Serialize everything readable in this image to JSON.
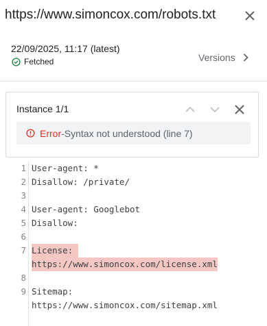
{
  "header": {
    "url": "https://www.simoncox.com/robots.txt",
    "close_icon": "close-icon"
  },
  "fetch": {
    "date": "22/09/2025, 11:17 (latest)",
    "status": "Fetched",
    "status_icon": "check-circle-icon",
    "versions_label": "Versions"
  },
  "instance": {
    "label": "Instance 1/1",
    "error_word": "Error",
    "separator": " - ",
    "error_message": "Syntax not understood (line 7)"
  },
  "colors": {
    "error": "#d93025",
    "success": "#188038",
    "highlight": "#f4c7c3"
  },
  "code": {
    "lines": [
      {
        "num": "1",
        "text": "User-agent: *"
      },
      {
        "num": "2",
        "text": "Disallow: /private/"
      },
      {
        "num": "3",
        "text": ""
      },
      {
        "num": "4",
        "text": "User-agent: Googlebot"
      },
      {
        "num": "5",
        "text": "Disallow:"
      },
      {
        "num": "6",
        "text": ""
      },
      {
        "num": "7",
        "text": "License: "
      },
      {
        "num": "",
        "text": "https://www.simoncox.com/license.xml"
      },
      {
        "num": "8",
        "text": ""
      },
      {
        "num": "9",
        "text": "Sitemap:"
      },
      {
        "num": "",
        "text": "https://www.simoncox.com/sitemap.xml"
      }
    ]
  }
}
